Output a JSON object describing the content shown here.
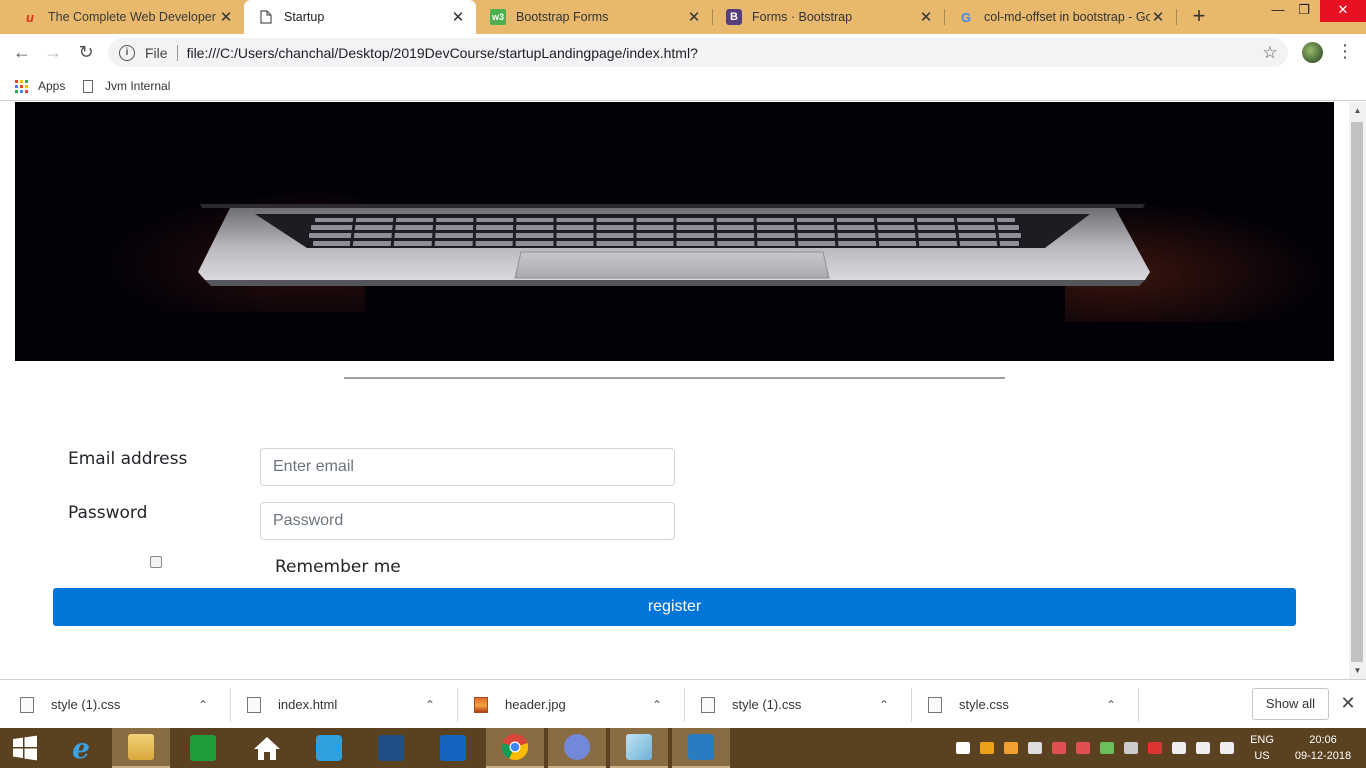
{
  "browser": {
    "tabs": [
      {
        "title": "The Complete Web Developer in",
        "favicon": "udemy-icon",
        "active": false
      },
      {
        "title": "Startup",
        "favicon": "page-icon",
        "active": true
      },
      {
        "title": "Bootstrap Forms",
        "favicon": "w3schools-icon",
        "active": false
      },
      {
        "title": "Forms · Bootstrap",
        "favicon": "bootstrap-icon",
        "active": false
      },
      {
        "title": "col-md-offset in bootstrap - Go",
        "favicon": "google-icon",
        "active": false
      }
    ],
    "new_tab_label": "+",
    "omnibox": {
      "scheme_label": "File",
      "url": "file:///C:/Users/chanchal/Desktop/2019DevCourse/startupLandingpage/index.html?"
    },
    "bookmarks": [
      {
        "label": "Apps",
        "icon": "apps-grid-icon"
      },
      {
        "label": "Jvm Internal",
        "icon": "page-icon"
      }
    ]
  },
  "page": {
    "hero_image": "laptop-keyboard-photo",
    "form": {
      "email_label": "Email address",
      "email_placeholder": "Enter email",
      "password_label": "Password",
      "password_placeholder": "Password",
      "remember_label": "Remember me",
      "submit_label": "register"
    }
  },
  "downloads": {
    "items": [
      {
        "name": "style (1).css",
        "icon": "css-file-icon"
      },
      {
        "name": "index.html",
        "icon": "html-file-icon"
      },
      {
        "name": "header.jpg",
        "icon": "image-file-icon"
      },
      {
        "name": "style (1).css",
        "icon": "css-file-icon"
      },
      {
        "name": "style.css",
        "icon": "css-file-icon"
      }
    ],
    "show_all_label": "Show all"
  },
  "taskbar": {
    "language": "ENG",
    "region": "US",
    "time": "20:06",
    "date": "09-12-2018"
  },
  "colors": {
    "tabstrip": "#e8b96d",
    "primary_button": "#0275d8",
    "taskbar": "#5a4220"
  }
}
